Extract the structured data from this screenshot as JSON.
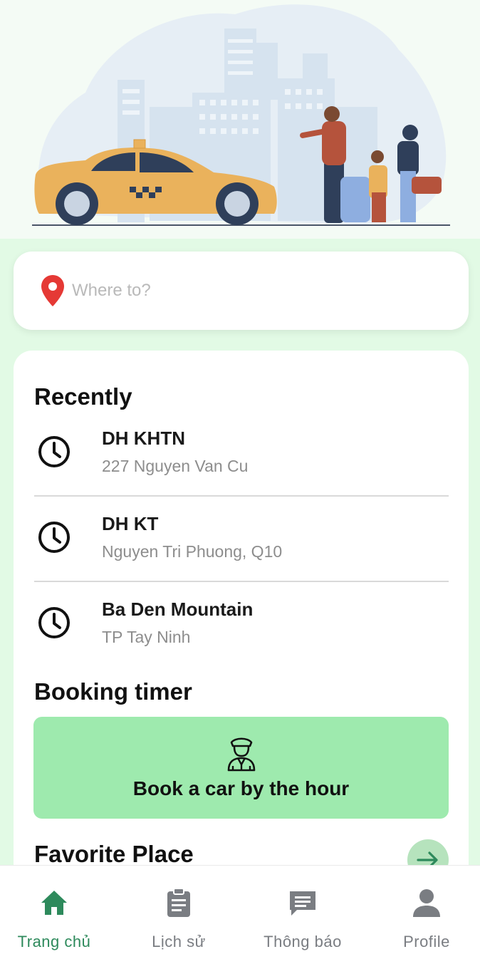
{
  "search": {
    "placeholder": "Where to?"
  },
  "recent": {
    "title": "Recently",
    "items": [
      {
        "name": "DH KHTN",
        "address": "227 Nguyen Van Cu"
      },
      {
        "name": "DH KT",
        "address": "Nguyen Tri Phuong, Q10"
      },
      {
        "name": "Ba Den Mountain",
        "address": "TP Tay Ninh"
      }
    ]
  },
  "booking": {
    "title": "Booking timer",
    "button_label": "Book a car by the hour"
  },
  "favorite": {
    "title": "Favorite Place"
  },
  "nav": {
    "items": [
      {
        "label": "Trang chủ",
        "icon": "home-icon",
        "active": true
      },
      {
        "label": "Lịch sử",
        "icon": "clipboard-icon",
        "active": false
      },
      {
        "label": "Thông báo",
        "icon": "chat-icon",
        "active": false
      },
      {
        "label": "Profile",
        "icon": "person-icon",
        "active": false
      }
    ]
  },
  "colors": {
    "accent": "#2e8a5c",
    "button_bg": "#9eeaae",
    "page_bg": "#e2fae5",
    "pin": "#e53935",
    "taxi": "#eab25c"
  }
}
